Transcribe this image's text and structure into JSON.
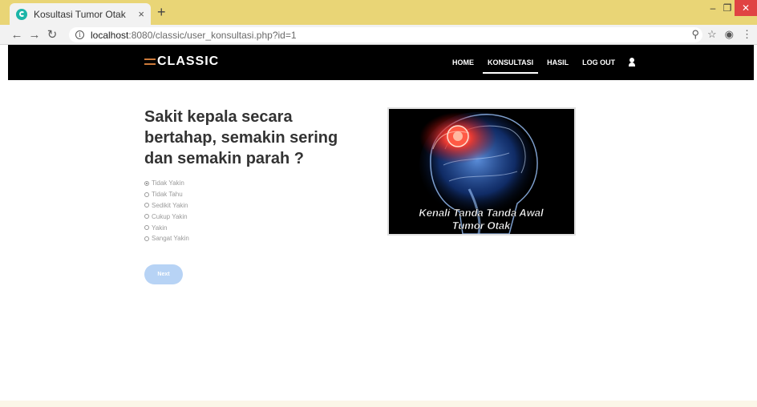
{
  "browser": {
    "tab_title": "Kosultasi Tumor Otak",
    "tab_close": "×",
    "new_tab": "+",
    "url_host": "localhost",
    "url_path": ":8080/classic/user_konsultasi.php?id=1",
    "info_glyph": "i"
  },
  "site": {
    "brand": "CLASSIC",
    "nav": [
      {
        "label": "HOME"
      },
      {
        "label": "KONSULTASI"
      },
      {
        "label": "HASIL"
      },
      {
        "label": "LOG OUT"
      }
    ],
    "active_nav": "KONSULTASI"
  },
  "question": {
    "text": "Sakit kepala secara bertahap, semakin sering dan semakin parah ?",
    "options": [
      {
        "label": "Tidak Yakin",
        "selected": true
      },
      {
        "label": "Tidak Tahu",
        "selected": false
      },
      {
        "label": "Sedikit Yakin",
        "selected": false
      },
      {
        "label": "Cukup Yakin",
        "selected": false
      },
      {
        "label": "Yakin",
        "selected": false
      },
      {
        "label": "Sangat Yakin",
        "selected": false
      }
    ],
    "next_label": "Next"
  },
  "image": {
    "caption_line1": "Kenali Tanda Tanda Awal",
    "caption_line2": "Tumor Otak"
  },
  "colors": {
    "tabbar": "#e9d576",
    "navbar": "#000000",
    "next_button": "#b7d3f5",
    "favicon": "#1bb5a8"
  }
}
